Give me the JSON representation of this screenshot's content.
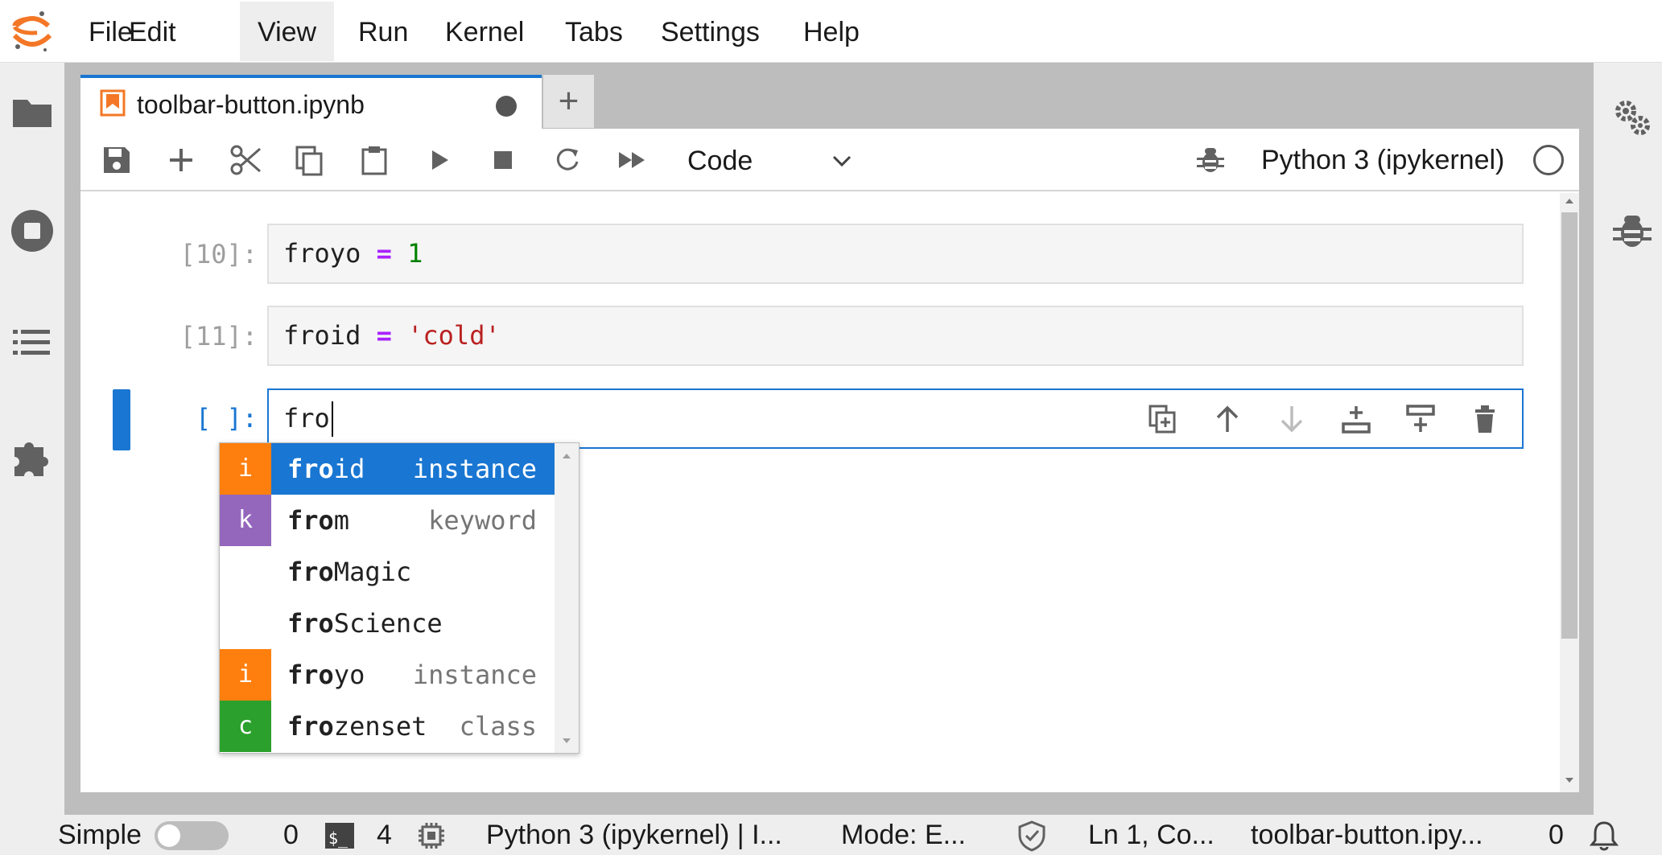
{
  "menu": {
    "items": [
      "File",
      "Edit",
      "View",
      "Run",
      "Kernel",
      "Tabs",
      "Settings",
      "Help"
    ],
    "active": "View"
  },
  "tab": {
    "title": "toolbar-button.ipynb",
    "add_label": "+"
  },
  "toolbar": {
    "cell_type": "Code",
    "kernel_name": "Python 3 (ipykernel)"
  },
  "cells": [
    {
      "prompt": "[10]:",
      "var": "froyo",
      "op": "=",
      "value": "1",
      "value_type": "number"
    },
    {
      "prompt": "[11]:",
      "var": "froid",
      "op": "=",
      "value": "'cold'",
      "value_type": "string"
    },
    {
      "prompt": "[ ]:",
      "input": "fro"
    }
  ],
  "completer": {
    "typed_prefix": "fro",
    "items": [
      {
        "type": "i",
        "prefix": "fro",
        "rest": "id",
        "kind": "instance",
        "color": "#ff7f0e",
        "active": true
      },
      {
        "type": "k",
        "prefix": "fro",
        "rest": "m",
        "kind": "keyword",
        "color": "#9467bd",
        "active": false
      },
      {
        "type": "",
        "prefix": "fro",
        "rest": "Magic",
        "kind": "",
        "color": "",
        "active": false
      },
      {
        "type": "",
        "prefix": "fro",
        "rest": "Science",
        "kind": "",
        "color": "",
        "active": false
      },
      {
        "type": "i",
        "prefix": "fro",
        "rest": "yo",
        "kind": "instance",
        "color": "#ff7f0e",
        "active": false
      },
      {
        "type": "c",
        "prefix": "fro",
        "rest": "zenset",
        "kind": "class",
        "color": "#2ca02c",
        "active": false
      }
    ]
  },
  "statusbar": {
    "mode_label": "Simple",
    "terminals_count": "0",
    "kernels_count": "4",
    "kernel_status": "Python 3 (ipykernel) | I...",
    "mode": "Mode: E...",
    "cursor_position": "Ln 1, Co...",
    "file_name": "toolbar-button.ipy...",
    "notifications_count": "0"
  },
  "colors": {
    "accent": "#1976d2",
    "logo_orange": "#f37726",
    "instance": "#ff7f0e",
    "keyword": "#9467bd",
    "class": "#2ca02c"
  }
}
